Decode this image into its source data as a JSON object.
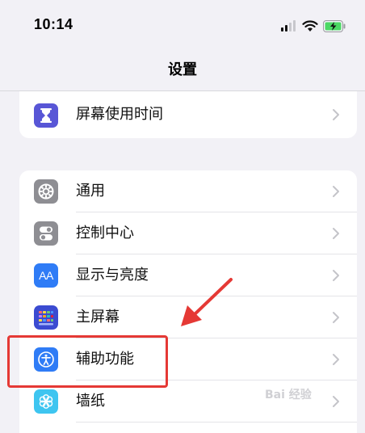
{
  "status_bar": {
    "time": "10:14",
    "icons": [
      "cellular-signal-icon",
      "wifi-icon",
      "battery-charging-icon"
    ],
    "battery_color": "#4cd964"
  },
  "nav": {
    "title": "设置"
  },
  "groups": [
    {
      "items": [
        {
          "label": "屏幕使用时间",
          "icon": "hourglass-icon",
          "icon_bg": "#5856d6"
        }
      ]
    },
    {
      "items": [
        {
          "label": "通用",
          "icon": "gear-icon",
          "icon_bg": "#8e8e93"
        },
        {
          "label": "控制中心",
          "icon": "toggles-icon",
          "icon_bg": "#8e8e93"
        },
        {
          "label": "显示与亮度",
          "icon": "aa-text-icon",
          "icon_bg": "#2f7cf6",
          "icon_text": "AA"
        },
        {
          "label": "主屏幕",
          "icon": "app-grid-icon",
          "icon_bg": "#3b4bd1"
        },
        {
          "label": "辅助功能",
          "icon": "accessibility-icon",
          "icon_bg": "#2f7cf6"
        },
        {
          "label": "墙纸",
          "icon": "flower-icon",
          "icon_bg": "#3ec5f0"
        }
      ]
    }
  ],
  "annotation": {
    "highlight_color": "#e53935",
    "highlighted_item": "辅助功能"
  },
  "watermark": {
    "text": "Bai 经验"
  }
}
